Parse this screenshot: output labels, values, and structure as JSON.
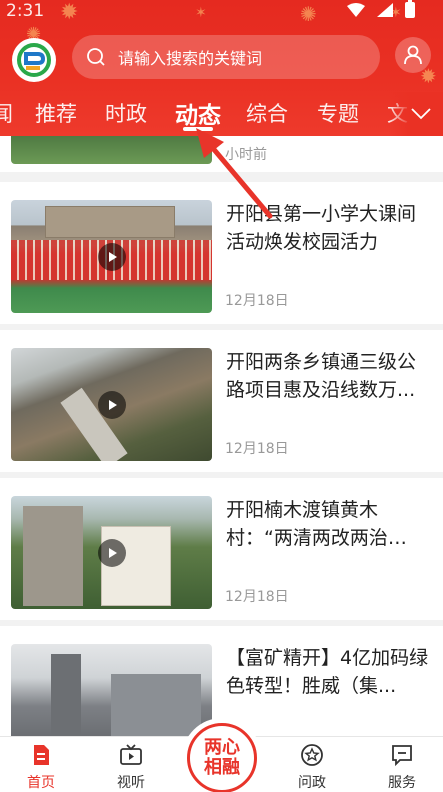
{
  "status": {
    "time": "2:31"
  },
  "search": {
    "placeholder": "请输入搜索的关键词"
  },
  "tabs": [
    {
      "label": "闻"
    },
    {
      "label": "推荐"
    },
    {
      "label": "时政"
    },
    {
      "label": "动态",
      "active": true
    },
    {
      "label": "综合"
    },
    {
      "label": "专题"
    },
    {
      "label": "文"
    }
  ],
  "feed": {
    "partial_time": "小时前",
    "items": [
      {
        "title": "开阳县第一小学大课间活动焕发校园活力",
        "date": "12月18日",
        "has_video": true
      },
      {
        "title": "开阳两条乡镇通三级公路项目惠及沿线数万...",
        "date": "12月18日",
        "has_video": true
      },
      {
        "title": "开阳楠木渡镇黄木村：“两清两改两治理”助...",
        "date": "12月18日",
        "has_video": true
      },
      {
        "title": "【富矿精开】4亿加码绿色转型！胜威（集...",
        "date": "",
        "has_video": false
      }
    ]
  },
  "bottom_nav": {
    "items": [
      {
        "label": "首页",
        "icon": "home-icon",
        "active": true
      },
      {
        "label": "视听",
        "icon": "tv-icon"
      },
      {
        "label": "问政",
        "icon": "star-badge-icon"
      },
      {
        "label": "服务",
        "icon": "message-icon"
      }
    ],
    "center_label": "两心相融"
  },
  "colors": {
    "brand_red": "#e8342a",
    "date_gray": "#999999"
  }
}
